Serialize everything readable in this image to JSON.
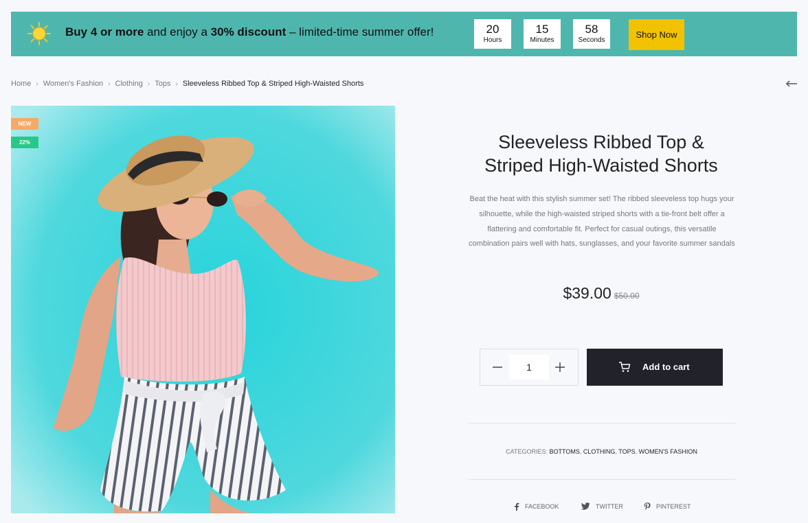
{
  "promo": {
    "text_bold_1": "Buy 4 or more",
    "text_1": " and enjoy a ",
    "text_bold_2": "30% discount",
    "text_2": " – limited-time summer offer!",
    "timer": [
      {
        "value": "20",
        "label": "Hours"
      },
      {
        "value": "15",
        "label": "Minutes"
      },
      {
        "value": "58",
        "label": "Seconds"
      }
    ],
    "button_label": "Shop Now",
    "colors": {
      "banner": "#4fb6ad",
      "button": "#f2c200"
    }
  },
  "breadcrumb": {
    "items": [
      "Home",
      "Women's Fashion",
      "Clothing",
      "Tops"
    ],
    "current": "Sleeveless Ribbed Top & Striped High-Waisted Shorts"
  },
  "product": {
    "badges": {
      "new": "NEW",
      "discount": "22%"
    },
    "title": "Sleeveless Ribbed Top & Striped High-Waisted Shorts",
    "description": "Beat the heat with this stylish summer set! The ribbed sleeveless top hugs your silhouette, while the high-waisted striped shorts with a tie-front belt offer a flattering and comfortable fit. Perfect for casual outings, this versatile combination pairs well with hats, sunglasses, and your favorite summer sandals",
    "price": "$39.00",
    "old_price": "$50.00",
    "quantity": "1",
    "add_to_cart_label": "Add to cart",
    "categories_label": "CATEGORIES: ",
    "categories": [
      "BOTTOMS",
      "CLOTHING",
      "TOPS",
      "WOMEN'S FASHION"
    ]
  },
  "share": {
    "facebook": "FACEBOOK",
    "twitter": "TWITTER",
    "pinterest": "PINTEREST"
  }
}
